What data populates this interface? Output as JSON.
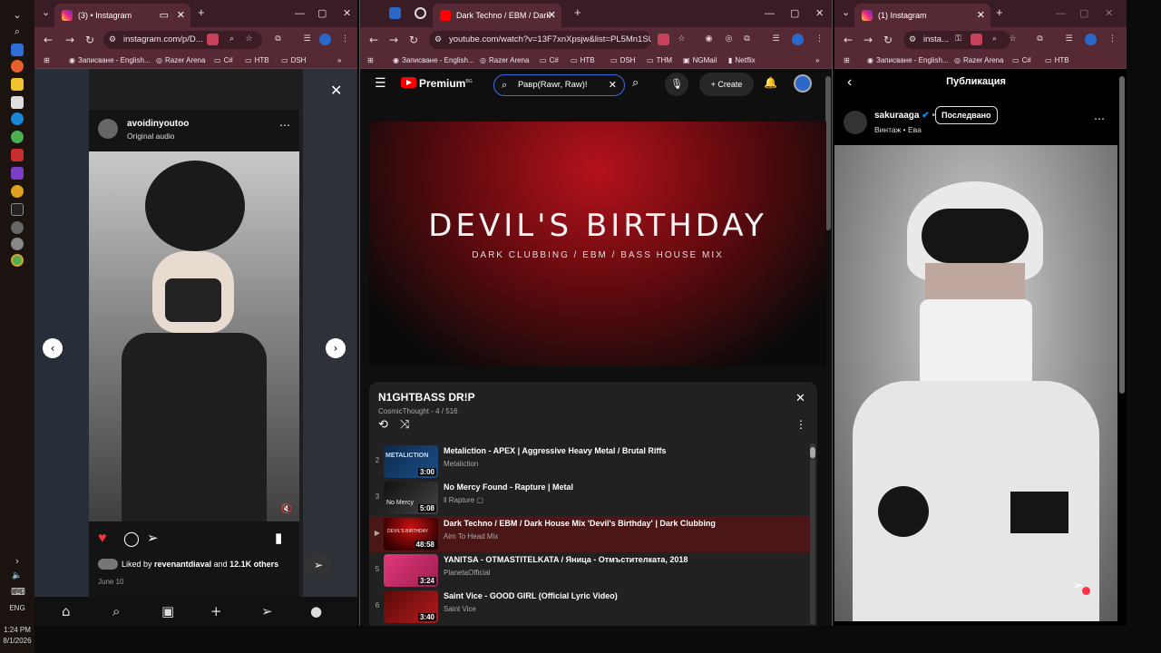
{
  "taskbar": {
    "time": "1:24 PM",
    "date": "8/1/2026",
    "lang": "ENG"
  },
  "left_window": {
    "tab_title": "(3) • Instagram",
    "url": "instagram.com/p/D...",
    "bookmarks": [
      "Записване - English...",
      "Razer Arena",
      "C#",
      "HTB",
      "DSH"
    ],
    "post": {
      "username": "avoidinyoutoo",
      "audio": "Original audio",
      "liked_by_prefix": "Liked by",
      "liked_by_user": "revenantdiaval",
      "liked_by_and": "and",
      "liked_by_count": "12.1K others",
      "date": "June 10"
    }
  },
  "middle_window": {
    "tab_title": "Dark Techno / EBM / Dark",
    "url": "youtube.com/watch?v=13F7xnXpsjw&list=PL5Mn1SUk...",
    "bookmarks": [
      "Записване - English...",
      "Razer Arena",
      "C#",
      "HTB",
      "DSH",
      "THM",
      "NGMail",
      "Netflix"
    ],
    "yt": {
      "logo_text": "Premium",
      "logo_sup": "BG",
      "search_value": "Равр(Rawr, Raw)!",
      "create_label": "Create"
    },
    "video": {
      "title": "DEVIL'S BIRTHDAY",
      "subtitle": "DARK CLUBBING / EBM / BASS HOUSE MIX"
    },
    "playlist": {
      "title": "N1GHTBASS DR!P",
      "meta": "CosmicThought - 4 / 516",
      "items": [
        {
          "num": "2",
          "title": "Metaliction - APEX | Aggressive Heavy Metal / Brutal Riffs",
          "channel": "Metaliction",
          "duration": "3:00",
          "thumb_text": "METALICTION"
        },
        {
          "num": "3",
          "title": "No Mercy Found - Rapture | Metal",
          "channel": "ll Rapture ▢",
          "duration": "5:08",
          "thumb_text": "No Mercy"
        },
        {
          "num": "▶",
          "title": "Dark Techno / EBM / Dark House Mix 'Devil's Birthday' | Dark Clubbing",
          "channel": "Aim To Head Mix",
          "duration": "48:58",
          "thumb_text": "DEVIL'S BIRTHDAY"
        },
        {
          "num": "5",
          "title": "YANITSA - OTMASTITELKATA / Яница - Отмъстителката, 2018",
          "channel": "PlanetaOfficial",
          "duration": "3:24",
          "thumb_text": ""
        },
        {
          "num": "6",
          "title": "Saint Vice - GOOD GIRL (Official Lyric Video)",
          "channel": "Saint Vice",
          "duration": "3:40",
          "thumb_text": ""
        }
      ]
    }
  },
  "right_window": {
    "tab_title": "(1) Instagram",
    "url": "insta...",
    "bookmarks": [
      "Записване - English...",
      "Razer Arena",
      "C#",
      "HTB"
    ],
    "header_title": "Публикация",
    "post": {
      "username": "sakuraaga",
      "follow_label": "Последвано",
      "audio": "Винтаж • Ева"
    }
  },
  "colors": {
    "chrome_tab_bg": "#3a1d24",
    "chrome_toolbar": "#552a35",
    "yt_red": "#ff0000",
    "ig_like": "#ff3040"
  }
}
